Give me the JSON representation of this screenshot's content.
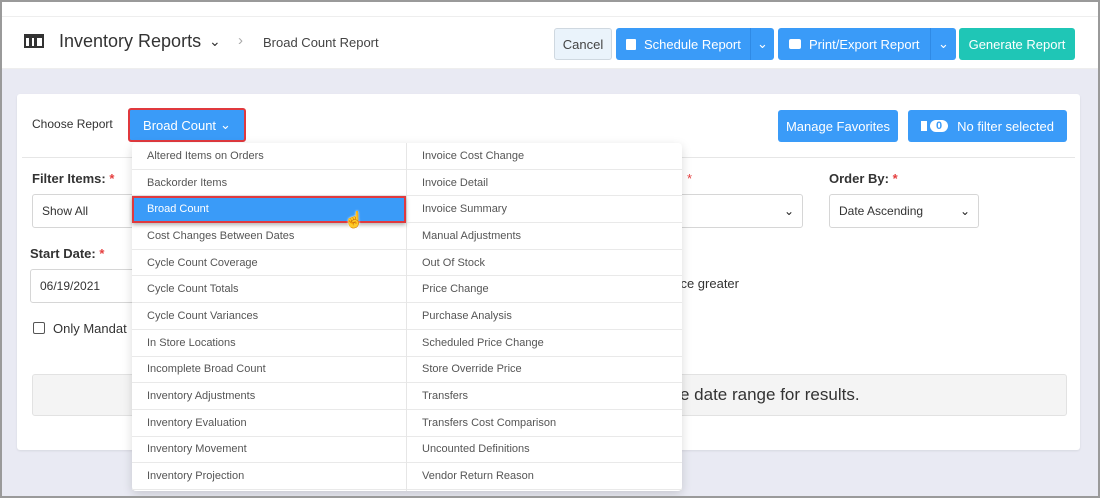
{
  "header": {
    "title": "Inventory Reports",
    "breadcrumb": "Broad Count Report",
    "cancel": "Cancel",
    "schedule": "Schedule Report",
    "print": "Print/Export Report",
    "generate": "Generate Report"
  },
  "choose": {
    "label": "Choose Report",
    "selected": "Broad Count",
    "manage": "Manage Favorites",
    "filter_count": "0",
    "filter_text": "No filter selected"
  },
  "form": {
    "filter_items_label": "Filter Items:",
    "filter_items_value": "Show All",
    "order_by_label": "Order By:",
    "order_by_value": "Date Ascending",
    "start_date_label": "Start Date:",
    "start_date_value": "06/19/2021",
    "partial_text": "ance greater",
    "checkbox_label": "Only Mandat",
    "info_text": "e date range for results.",
    "req": "*"
  },
  "menu": {
    "left": [
      "Altered Items on Orders",
      "Backorder Items",
      "Broad Count",
      "Cost Changes Between Dates",
      "Cycle Count Coverage",
      "Cycle Count Totals",
      "Cycle Count Variances",
      "In Store Locations",
      "Incomplete Broad Count",
      "Inventory Adjustments",
      "Inventory Evaluation",
      "Inventory Movement",
      "Inventory Projection"
    ],
    "right": [
      "Invoice Cost Change",
      "Invoice Detail",
      "Invoice Summary",
      "Manual Adjustments",
      "Out Of Stock",
      "Price Change",
      "Purchase Analysis",
      "Scheduled Price Change",
      "Store Override Price",
      "Transfers",
      "Transfers Cost Comparison",
      "Uncounted Definitions",
      "Vendor Return Reason"
    ],
    "active": "Broad Count"
  },
  "colors": {
    "primary": "#3a9bf8",
    "success": "#1fc6b6",
    "highlight": "#e0393e"
  }
}
